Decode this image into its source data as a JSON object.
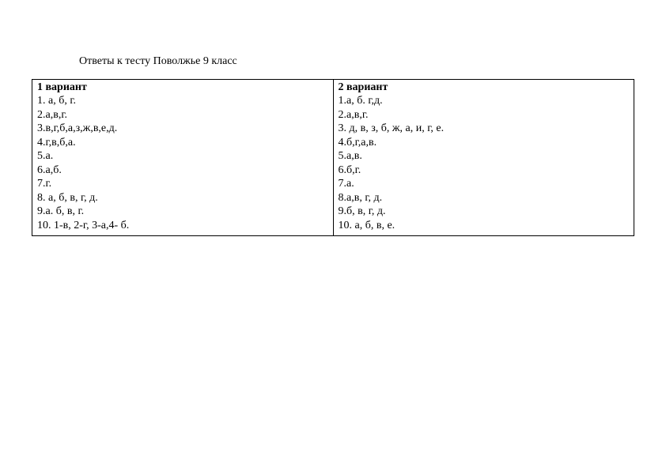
{
  "title": "Ответы к тесту Поволжье 9 класс",
  "variant1": {
    "header": "1 вариант",
    "lines": [
      "1. а, б, г.",
      "2.а,в,г.",
      "3.в,г,б,а,з,ж,в,е,д.",
      "4.г,в,б,а.",
      "5.а.",
      "6.а,б.",
      "7.г.",
      "8. а, б, в, г, д.",
      "9.а. б, в, г.",
      "10. 1-в, 2-г, 3-а,4- б."
    ]
  },
  "variant2": {
    "header": "2 вариант",
    "lines": [
      "1.а, б. г,д.",
      "2.а,в,г.",
      "3. д, в, з, б, ж, а, и, г, е.",
      "4.б,г,а,в.",
      "5.а,в.",
      "6.б,г.",
      "7.а.",
      "8.а,в, г, д.",
      "9.б, в, г, д.",
      "10. а, б, в, е."
    ]
  }
}
